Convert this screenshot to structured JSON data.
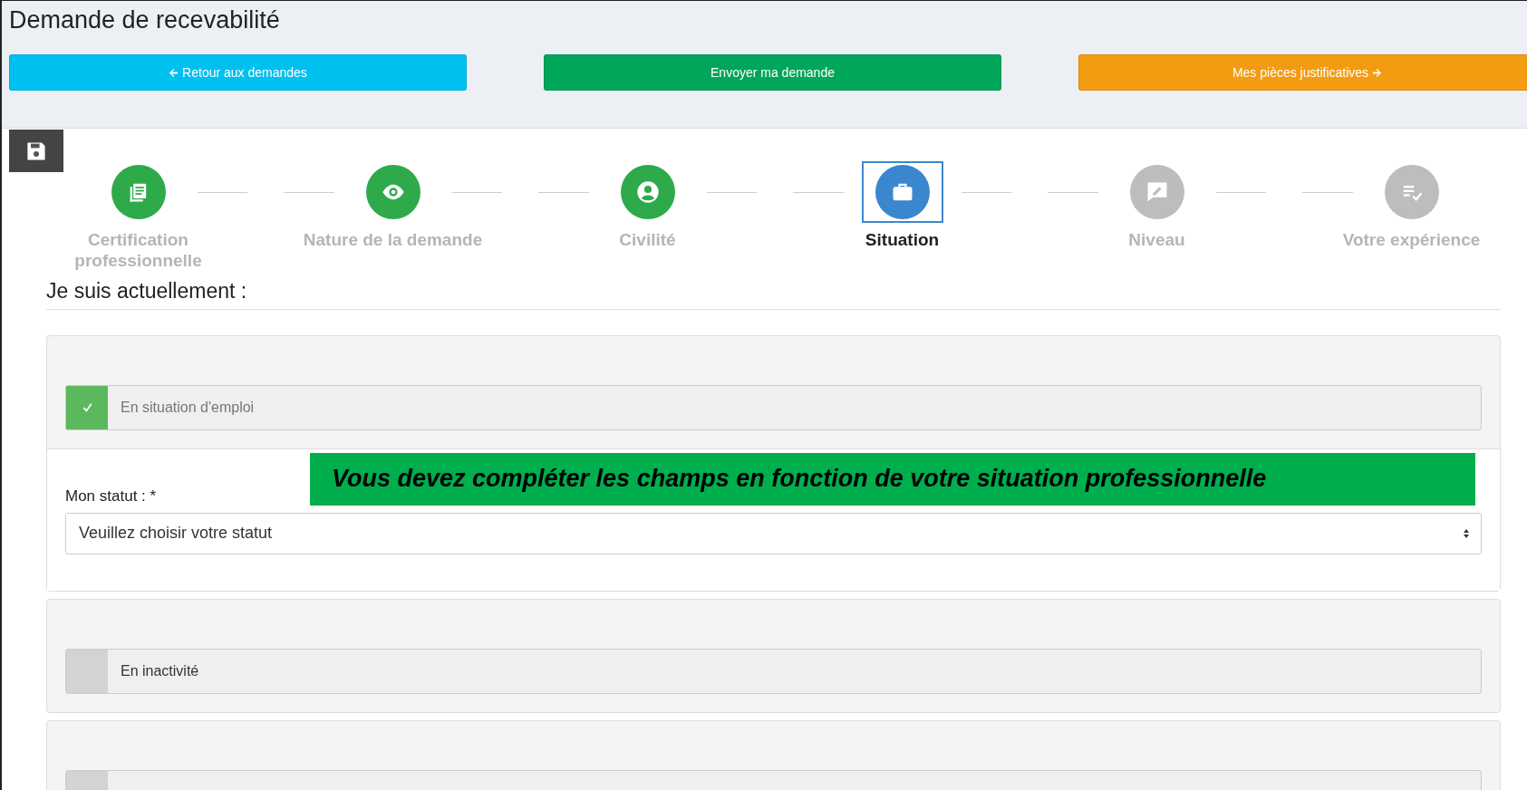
{
  "title": "Demande de recevabilité",
  "actions": [
    {
      "label": "Retour aux demandes",
      "kind": "back"
    },
    {
      "label": "Envoyer ma demande",
      "kind": "send"
    },
    {
      "label": "Mes pièces justificatives",
      "kind": "next"
    }
  ],
  "steps": [
    {
      "label": "Certification professionnelle",
      "done": true,
      "selected": false
    },
    {
      "label": "Nature de la demande",
      "done": true,
      "selected": false
    },
    {
      "label": "Civilité",
      "done": true,
      "selected": false
    },
    {
      "label": "Situation",
      "done": false,
      "selected": true
    },
    {
      "label": "Niveau",
      "done": false,
      "selected": false
    },
    {
      "label": "Votre expérience",
      "done": false,
      "selected": false
    }
  ],
  "section_title": "Je suis actuellement :",
  "situations": [
    {
      "label": "En situation d'emploi",
      "checked": true,
      "field": {
        "label": "Mon statut : *",
        "placeholder": "Veuillez choisir votre statut"
      },
      "notice": "Vous devez compléter les champs en fonction de votre situation professionnelle"
    },
    {
      "label": "En inactivité",
      "checked": false
    },
    {
      "checked": false
    }
  ]
}
